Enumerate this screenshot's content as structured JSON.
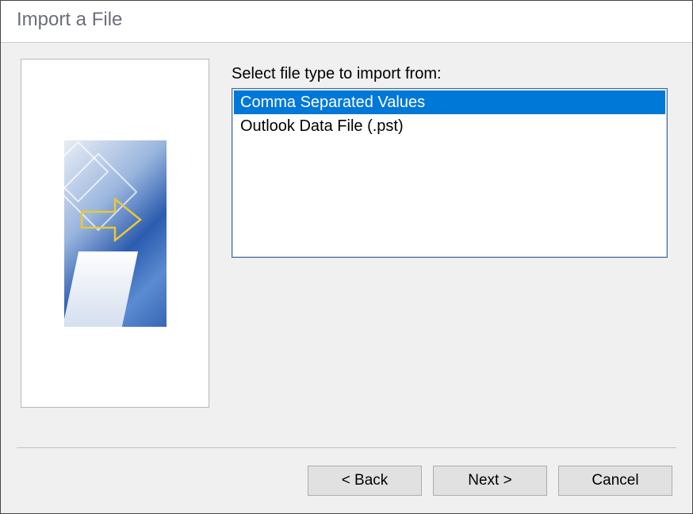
{
  "dialog": {
    "title": "Import a File"
  },
  "main": {
    "label": "Select file type to import from:",
    "options": [
      {
        "label": "Comma Separated Values",
        "selected": true
      },
      {
        "label": "Outlook Data File (.pst)",
        "selected": false
      }
    ]
  },
  "buttons": {
    "back": "< Back",
    "next": "Next >",
    "cancel": "Cancel"
  }
}
